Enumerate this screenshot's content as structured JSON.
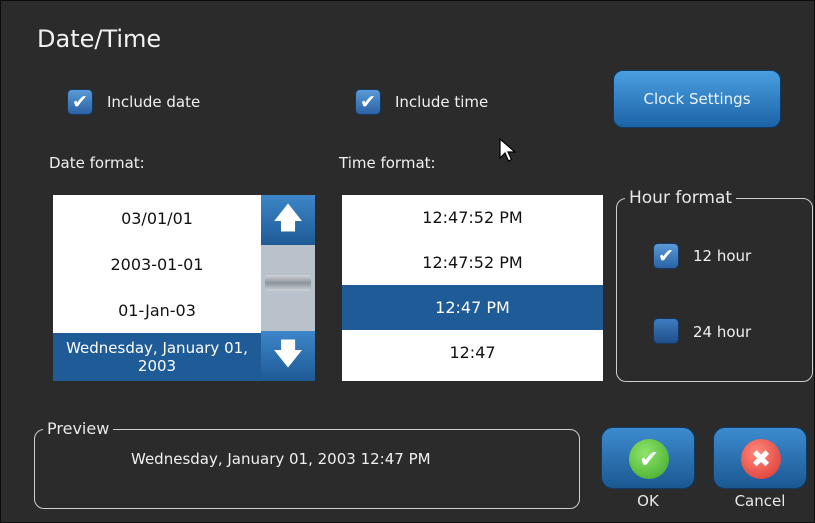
{
  "dialog": {
    "title": "Date/Time",
    "include_date": {
      "label": "Include date",
      "checked": true
    },
    "include_time": {
      "label": "Include time",
      "checked": true
    },
    "clock_settings_label": "Clock Settings",
    "date_format": {
      "label": "Date format:",
      "options": [
        "03/01/01",
        "2003-01-01",
        "01-Jan-03",
        "Wednesday, January 01, 2003"
      ],
      "selected_index": 3
    },
    "time_format": {
      "label": "Time format:",
      "options": [
        "12:47:52 PM",
        "12:47:52 PM",
        "12:47 PM",
        "12:47"
      ],
      "selected_index": 2
    },
    "hour_format": {
      "legend": "Hour format",
      "options": [
        {
          "label": "12 hour",
          "checked": true
        },
        {
          "label": "24 hour",
          "checked": false
        }
      ]
    },
    "preview": {
      "legend": "Preview",
      "text": "Wednesday, January 01, 2003 12:47 PM"
    },
    "ok_label": "OK",
    "cancel_label": "Cancel"
  },
  "colors": {
    "background": "#2b2b2b",
    "accent": "#1f5b96",
    "ok": "#4cc033",
    "cancel": "#e0403a"
  },
  "icons": {
    "ok": "checkmark-icon",
    "cancel": "x-icon",
    "up": "arrow-up-icon",
    "down": "arrow-down-icon"
  }
}
